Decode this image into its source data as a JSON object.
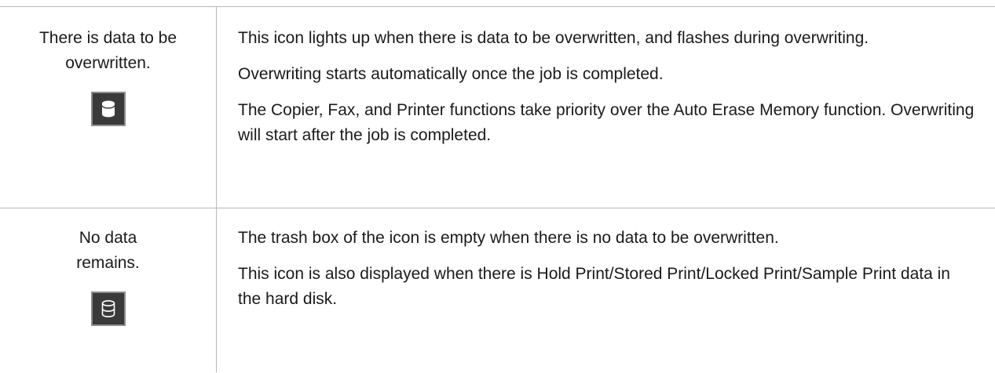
{
  "rows": [
    {
      "status": "There is data to be overwritten.",
      "icon": "database-filled-icon",
      "paragraphs": [
        "This icon lights up when there is data to be overwritten, and flashes during overwriting.",
        "Overwriting starts automatically once the job is completed.",
        "The Copier, Fax, and Printer functions take priority over the Auto Erase Memory function. Overwriting will start after the job is completed."
      ]
    },
    {
      "status": "No data remains.",
      "icon": "database-empty-icon",
      "paragraphs": [
        "The trash box of the icon is empty when there is no data to be overwritten.",
        "This icon is also displayed when there is Hold Print/Stored Print/Locked Print/Sample Print data in the hard disk."
      ]
    }
  ]
}
